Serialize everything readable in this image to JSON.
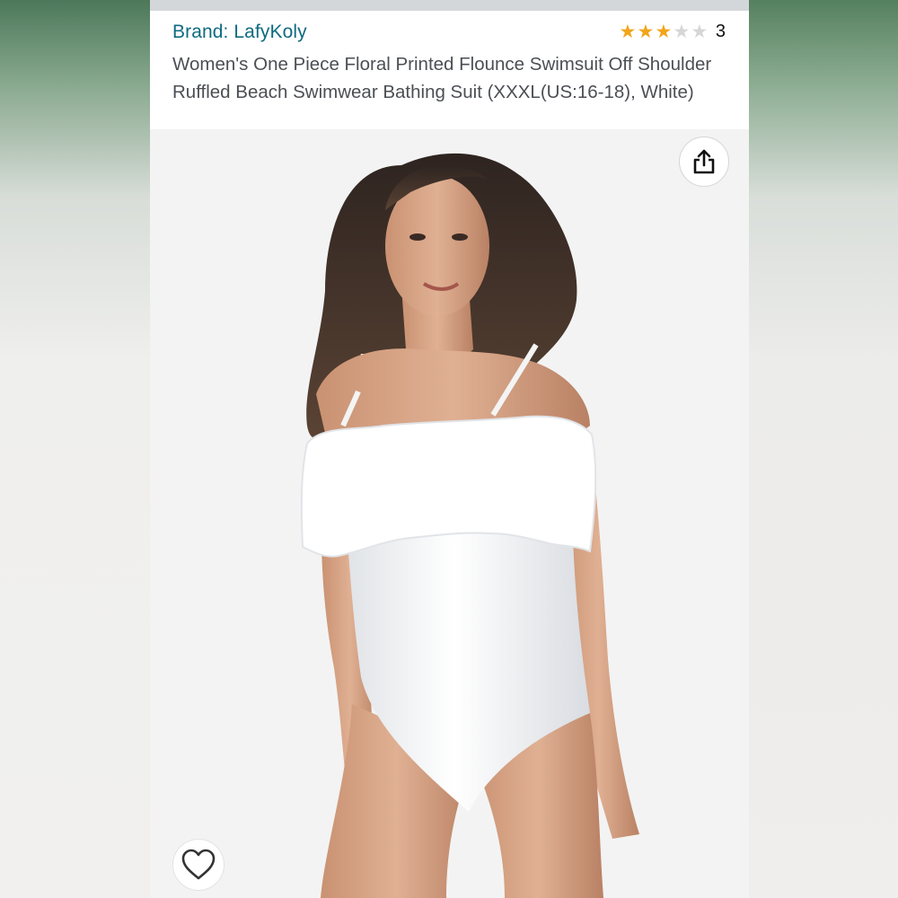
{
  "product": {
    "brand": "Brand: LafyKoly",
    "rating": {
      "stars": 3,
      "max_stars": 5,
      "count": "3"
    },
    "title": "Women's One Piece Floral Printed Flounce Swimsuit Off Shoulder Ruffled Beach Swimwear Bathing Suit (XXXL(US:16-18), White)"
  },
  "actions": {
    "share_icon": "share-icon",
    "favorite_icon": "heart-icon"
  },
  "image": {
    "subject": "model-in-white-off-shoulder-ruffle-swimsuit"
  },
  "colors": {
    "brand_link": "#0f6b80",
    "star_filled": "#f1a51a",
    "star_empty": "#d6d6d6",
    "title_text": "#4b4f54"
  }
}
